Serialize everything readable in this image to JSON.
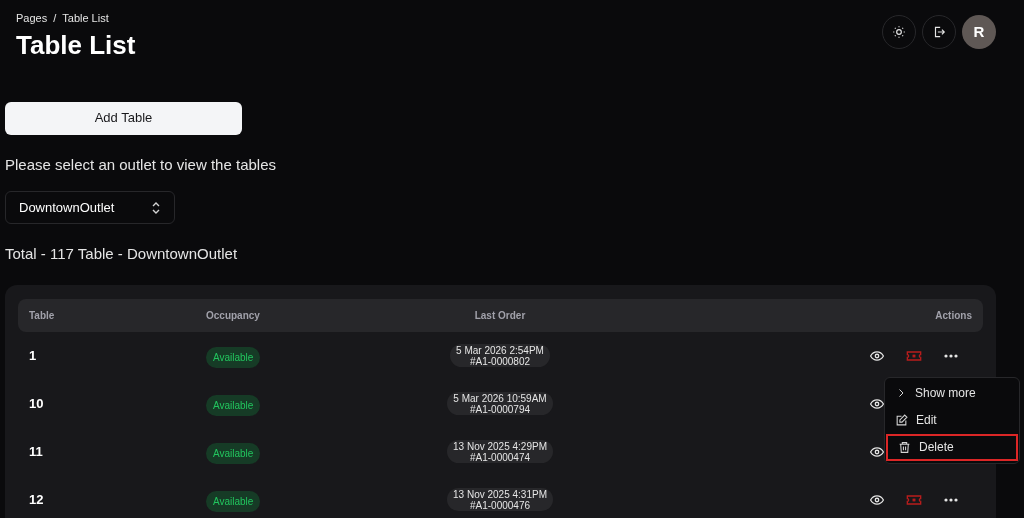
{
  "breadcrumb": {
    "items": [
      "Pages",
      "Table List"
    ],
    "separator": "/"
  },
  "title": "Table List",
  "header_buttons": [
    {
      "kind": "theme"
    },
    {
      "kind": "logout"
    }
  ],
  "avatar": {
    "initial": "R"
  },
  "add_button": "Add Table",
  "prompt": "Please select an outlet to view the tables",
  "outlet_select": {
    "value": "DowntownOutlet"
  },
  "total": "Total - 117 Table - DowntownOutlet",
  "table": {
    "columns": [
      "Table",
      "Occupancy",
      "Last Order",
      "Actions"
    ],
    "rows": [
      {
        "table": "1",
        "occupancy": "Available",
        "last_order_time": "5 Mar 2026 2:54PM",
        "last_order_id": "#A1-0000802",
        "menu_open": true
      },
      {
        "table": "10",
        "occupancy": "Available",
        "last_order_time": "5 Mar 2026 10:59AM",
        "last_order_id": "#A1-0000794",
        "menu_open": false
      },
      {
        "table": "11",
        "occupancy": "Available",
        "last_order_time": "13 Nov 2025 4:29PM",
        "last_order_id": "#A1-0000474",
        "menu_open": false
      },
      {
        "table": "12",
        "occupancy": "Available",
        "last_order_time": "13 Nov 2025 4:31PM",
        "last_order_id": "#A1-0000476",
        "menu_open": false
      }
    ]
  },
  "menu": [
    {
      "kind": "more",
      "label": "Show more",
      "highlighted": false
    },
    {
      "kind": "edit",
      "label": "Edit",
      "highlighted": false
    },
    {
      "kind": "delete",
      "label": "Delete",
      "highlighted": true
    }
  ]
}
